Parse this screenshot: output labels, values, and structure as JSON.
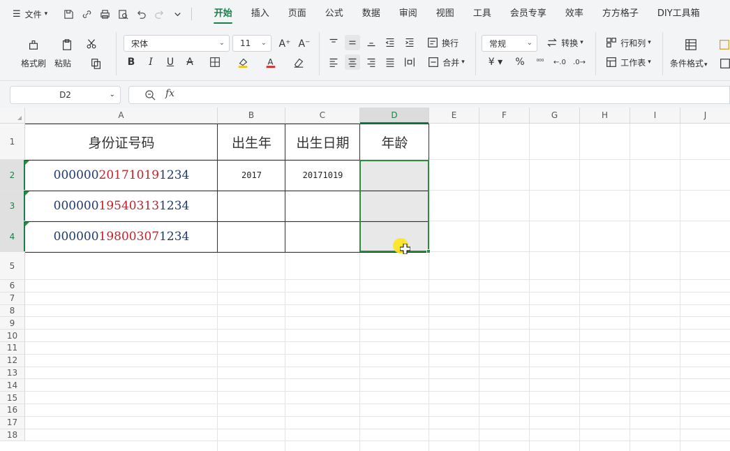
{
  "menubar": {
    "file_label": "文件",
    "tabs": [
      "开始",
      "插入",
      "页面",
      "公式",
      "数据",
      "审阅",
      "视图",
      "工具",
      "会员专享",
      "效率",
      "方方格子",
      "DIY工具箱"
    ],
    "active_tab": "开始"
  },
  "ribbon": {
    "format_painter": "格式刷",
    "paste": "粘贴",
    "font_name": "宋体",
    "font_size": "11",
    "wrap_text": "换行",
    "merge": "合并",
    "number_format": "常规",
    "convert": "转换",
    "rows_cols": "行和列",
    "worksheet": "工作表",
    "conditional_format": "条件格式"
  },
  "formula_bar": {
    "name_box": "D2",
    "fx_label": "fx",
    "formula": ""
  },
  "sheet": {
    "columns": [
      "A",
      "B",
      "C",
      "D",
      "E",
      "F",
      "G",
      "H",
      "I",
      "J"
    ],
    "selected_column": "D",
    "rows": [
      "1",
      "2",
      "3",
      "4",
      "5",
      "6",
      "7",
      "8",
      "9",
      "10",
      "11",
      "12",
      "13",
      "14",
      "15",
      "16",
      "17",
      "18"
    ],
    "selected_rows": [
      "2",
      "3",
      "4"
    ],
    "header_row": {
      "a": "身份证号码",
      "b": "出生年",
      "c": "出生日期",
      "d": "年龄"
    },
    "data_rows": [
      {
        "id_prefix": "000000",
        "id_mid": "20171019",
        "id_suffix": "1234",
        "year": "2017",
        "date": "20171019",
        "age": ""
      },
      {
        "id_prefix": "000000",
        "id_mid": "19540313",
        "id_suffix": "1234",
        "year": "",
        "date": "",
        "age": ""
      },
      {
        "id_prefix": "000000",
        "id_mid": "19800307",
        "id_suffix": "1234",
        "year": "",
        "date": "",
        "age": ""
      }
    ]
  },
  "colors": {
    "accent": "#1a7f4b",
    "id_text": "#1f3a6b",
    "id_highlight": "#c0232b"
  }
}
